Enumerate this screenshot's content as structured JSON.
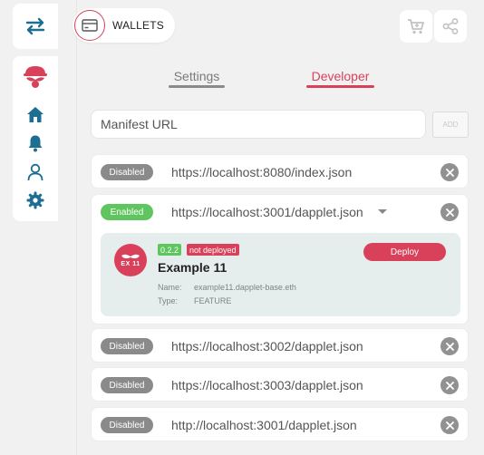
{
  "header": {
    "wallets_label": "WALLETS"
  },
  "tabs": [
    {
      "label": "Settings",
      "active": false
    },
    {
      "label": "Developer",
      "active": true
    }
  ],
  "manifest": {
    "placeholder": "Manifest URL",
    "add_label": "ADD"
  },
  "registries": [
    {
      "status": "Disabled",
      "url": "https://localhost:8080/index.json"
    },
    {
      "status": "Enabled",
      "url": "https://localhost:3001/dapplet.json"
    },
    {
      "status": "Disabled",
      "url": "https://localhost:3002/dapplet.json"
    },
    {
      "status": "Disabled",
      "url": "https://localhost:3003/dapplet.json"
    },
    {
      "status": "Disabled",
      "url": "http://localhost:3001/dapplet.json"
    }
  ],
  "dapplet": {
    "logo_text": "EX 11",
    "version": "0.2.2",
    "deploy_status": "not deployed",
    "title": "Example 11",
    "name_label": "Name:",
    "name_value": "example11.dapplet-base.eth",
    "type_label": "Type:",
    "type_value": "FEATURE",
    "deploy_label": "Deploy"
  },
  "colors": {
    "accent": "#d9415b",
    "enabled": "#5fc55f",
    "disabled": "#8a8a8a",
    "sidebar_icon": "#1c6f93"
  }
}
